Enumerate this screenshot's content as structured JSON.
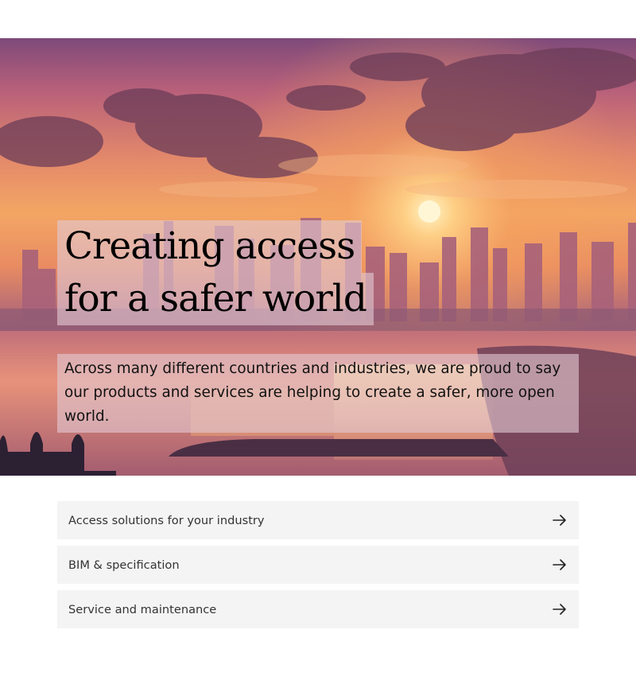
{
  "hero": {
    "headline_line1": "Creating access",
    "headline_line2": "for a safer world",
    "lede": "Across many different countries and industries, we are proud to say our products and services are helping to create a safer, more open world."
  },
  "links": [
    {
      "label": "Access solutions for your industry",
      "icon": "arrow-right-icon"
    },
    {
      "label": "BIM & specification",
      "icon": "arrow-right-icon"
    },
    {
      "label": "Service and maintenance",
      "icon": "arrow-right-icon"
    }
  ],
  "colors": {
    "link_background": "#f4f4f4",
    "overlay": "#e2c8d2",
    "sun": "#ffe7a8"
  }
}
